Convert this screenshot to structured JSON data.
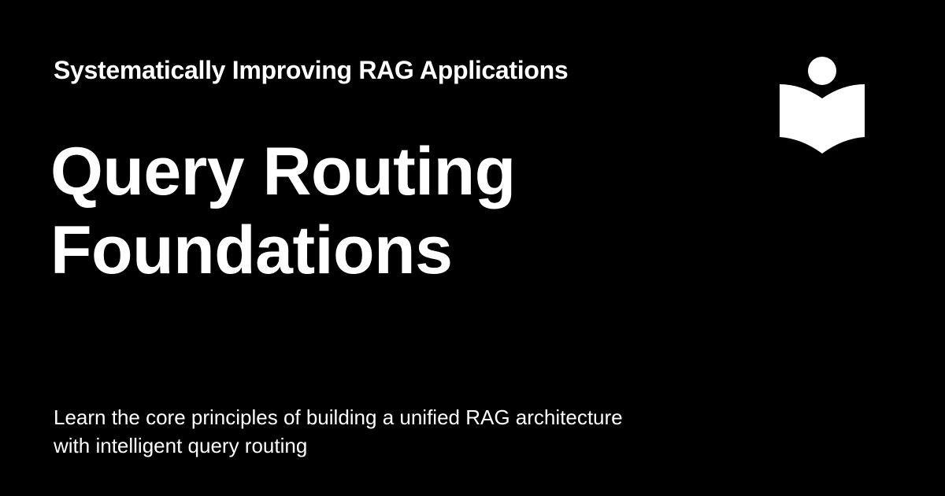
{
  "site": {
    "name": "Systematically Improving RAG Applications",
    "logo_icon": "reader-book-icon"
  },
  "page": {
    "title_lines": [
      "Query Routing",
      "Foundations"
    ],
    "description_lines": [
      "Learn the core principles of building a unified RAG architecture",
      "with intelligent query routing"
    ]
  },
  "colors": {
    "background": "#000000",
    "foreground": "#ffffff"
  }
}
